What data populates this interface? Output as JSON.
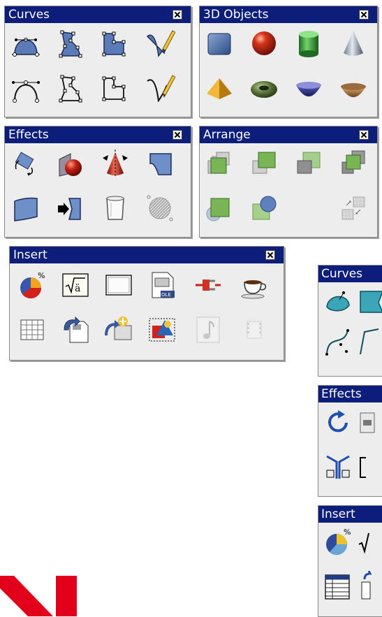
{
  "panels": {
    "curves": {
      "title": "Curves"
    },
    "objects3d": {
      "title": "3D Objects"
    },
    "effects": {
      "title": "Effects"
    },
    "arrange": {
      "title": "Arrange"
    },
    "insert": {
      "title": "Insert"
    },
    "curves_alt": {
      "title": "Curves"
    },
    "effects_alt": {
      "title": "Effects"
    },
    "insert_alt": {
      "title": "Insert"
    }
  },
  "icons": {
    "curves": [
      "filled-curve-icon",
      "filled-polygon-icon",
      "filled-polygon-45-icon",
      "filled-freeform-icon",
      "curve-icon",
      "polygon-icon",
      "polygon-45-icon",
      "freeform-line-icon"
    ],
    "objects3d": [
      "cube-icon",
      "sphere-icon",
      "cylinder-icon",
      "cone-icon",
      "pyramid-icon",
      "torus-icon",
      "shell-icon",
      "half-sphere-icon"
    ],
    "effects": [
      "rotate-icon",
      "flip-icon",
      "in-3d-rotation-object-icon",
      "set-in-circle-perspective-icon",
      "set-to-circle-slant-icon",
      "transparency-icon",
      "in-3d-lathe-icon",
      "gradient-icon"
    ],
    "arrange": [
      "bring-to-front-icon",
      "bring-forward-icon",
      "send-backward-icon",
      "send-to-back-icon",
      "in-front-of-object-icon",
      "behind-object-icon",
      "reverse-icon"
    ],
    "insert": [
      "chart-icon",
      "formula-icon",
      "frame-icon",
      "ole-object-icon",
      "plugin-icon",
      "applet-icon",
      "spreadsheet-icon",
      "insert-file-icon",
      "insert-object-icon",
      "image-icon",
      "sound-icon",
      "video-icon"
    ]
  },
  "colors": {
    "titlebar": "#0c1d7a",
    "panel": "#ededed",
    "logo": "#e3001b"
  }
}
